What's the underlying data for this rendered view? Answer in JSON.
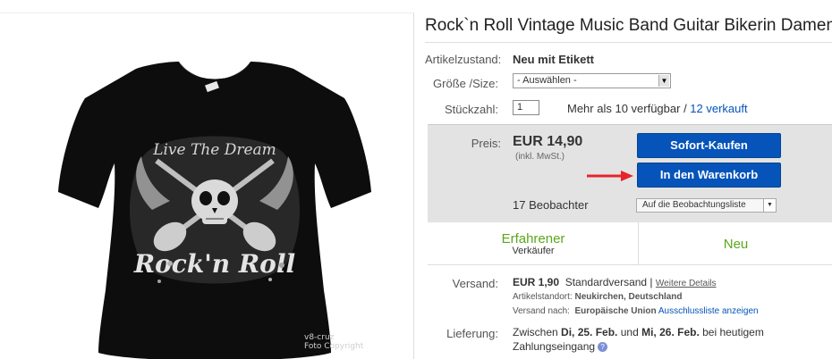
{
  "product": {
    "title": "Rock`n Roll Vintage Music Band Guitar Bikerin Damen Girl",
    "image": {
      "icon": "tshirt-skull-guitars-icon",
      "print_text_top": "Live The Dream",
      "print_text_bottom": "Rock'n Roll",
      "watermark_line1": "v8-cruz",
      "watermark_line2": "Foto Copyright"
    }
  },
  "details": {
    "condition_label": "Artikelzustand:",
    "condition_value": "Neu mit Etikett",
    "size_label": "Größe /Size:",
    "size_selected": "- Auswählen -",
    "qty_label": "Stückzahl:",
    "qty_value": "1",
    "availability": "Mehr als 10 verfügbar",
    "availability_sep": " / ",
    "sold_link": "12 verkauft"
  },
  "buybox": {
    "price_label": "Preis:",
    "price_value": "EUR 14,90",
    "price_note": "(inkl. MwSt.)",
    "buy_now": "Sofort-Kaufen",
    "add_to_cart": "In den Warenkorb",
    "watchers": "17 Beobachter",
    "watch_button": "Auf die Beobachtungsliste"
  },
  "seller": {
    "badge": "Erfahrener",
    "badge_sub": "Verkäufer",
    "condition_badge": "Neu"
  },
  "shipping": {
    "label": "Versand:",
    "cost": "EUR 1,90",
    "method": "Standardversand |",
    "details_link": "Weitere Details",
    "location_label": "Artikelstandort:",
    "location_value": "Neukirchen, Deutschland",
    "shipto_label": "Versand nach:",
    "shipto_value": "Europäische Union",
    "exclusion_link": "Ausschlussliste anzeigen"
  },
  "delivery": {
    "label": "Lieferung:",
    "prefix": "Zwischen ",
    "date_from": "Di, 25. Feb.",
    "connector": " und ",
    "date_to": "Mi, 26. Feb.",
    "suffix": " bei heutigem Zahlungseingang"
  },
  "colors": {
    "primary_button": "#0654ba",
    "seller_green": "#5ba71b",
    "arrow_red": "#e8242b"
  }
}
